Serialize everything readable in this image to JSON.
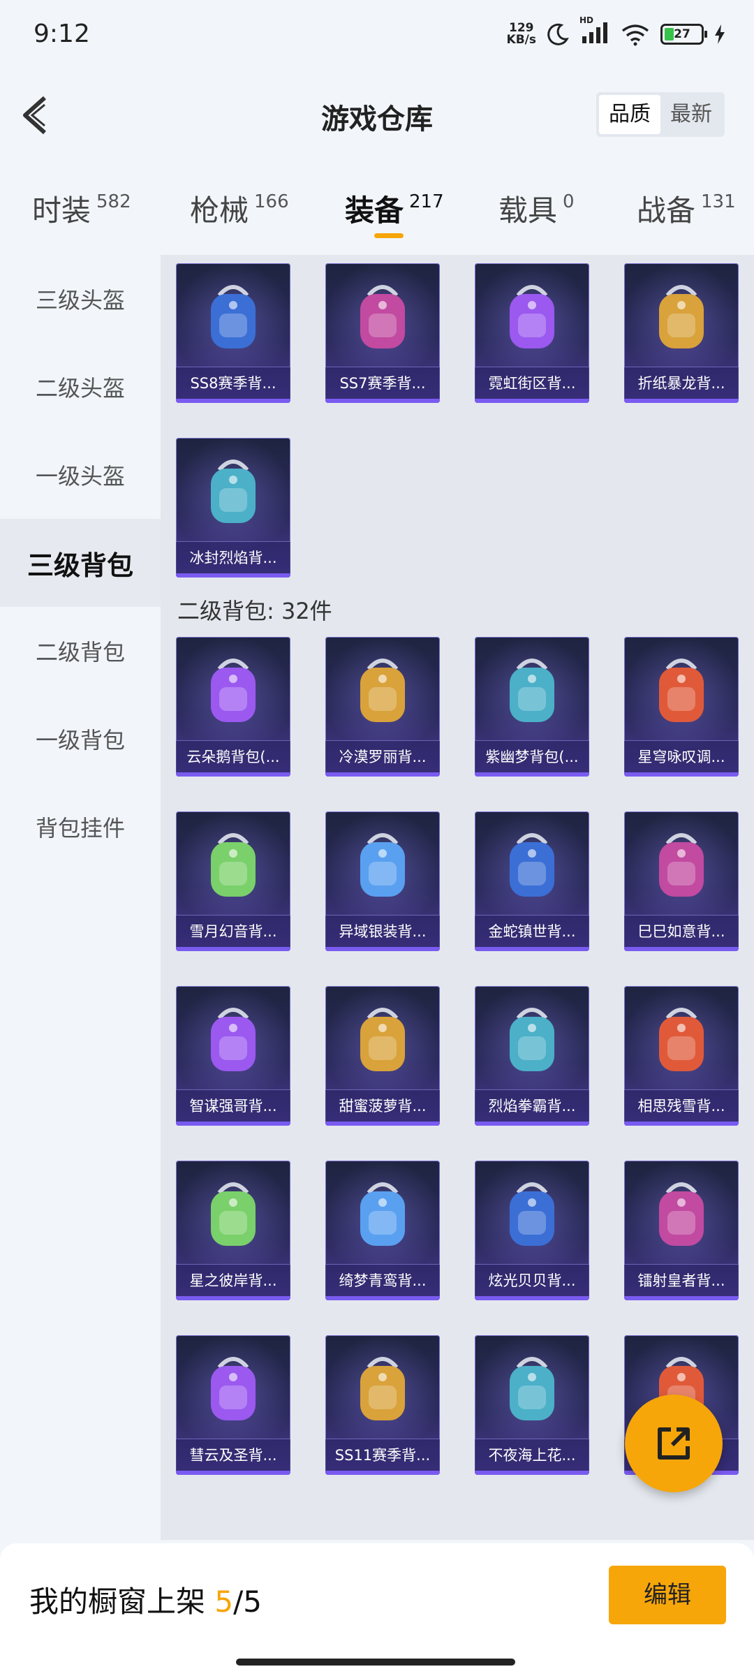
{
  "status_bar": {
    "time": "9:12",
    "net_speed_value": "129",
    "net_speed_unit": "KB/s",
    "hd_label": "HD",
    "battery_level": "27"
  },
  "header": {
    "title": "游戏仓库",
    "sort_options": [
      "品质",
      "最新"
    ],
    "active_sort": "品质"
  },
  "tabs": [
    {
      "label": "时装",
      "count": "582"
    },
    {
      "label": "枪械",
      "count": "166"
    },
    {
      "label": "装备",
      "count": "217"
    },
    {
      "label": "载具",
      "count": "0"
    },
    {
      "label": "战备",
      "count": "131"
    }
  ],
  "active_tab": "装备",
  "sidebar": {
    "items": [
      {
        "label": "三级头盔"
      },
      {
        "label": "二级头盔"
      },
      {
        "label": "一级头盔"
      },
      {
        "label": "三级背包"
      },
      {
        "label": "二级背包"
      },
      {
        "label": "一级背包"
      },
      {
        "label": "背包挂件"
      }
    ],
    "active": "三级背包"
  },
  "level3_items": [
    "SS8赛季背...",
    "SS7赛季背...",
    "霓虹街区背...",
    "折纸暴龙背...",
    "冰封烈焰背..."
  ],
  "level2_section": {
    "title": "二级背包: 32件",
    "items": [
      "云朵鹅背包(...",
      "冷漠罗丽背...",
      "紫幽梦背包(...",
      "星穹咏叹调...",
      "雪月幻音背...",
      "异域银装背...",
      "金蛇镇世背...",
      "巳巳如意背...",
      "智谋强哥背...",
      "甜蜜菠萝背...",
      "烈焰拳霸背...",
      "相思残雪背...",
      "星之彼岸背...",
      "绮梦青鸾背...",
      "炫光贝贝背...",
      "镭射皇者背...",
      "彗云及圣背...",
      "SS11赛季背...",
      "不夜海上花...",
      ""
    ]
  },
  "bottom_bar": {
    "prefix": "我的橱窗上架 ",
    "current": "5",
    "separator": "/",
    "total": "5",
    "edit_label": "编辑"
  },
  "colors": {
    "accent": "#f6a609",
    "card_top": "#1e2440",
    "card_bottom": "#4a3c92",
    "card_strip": "#7a5bf0"
  },
  "icons": [
    "back-arrow-icon",
    "moon-icon",
    "signal-icon",
    "wifi-icon",
    "battery-icon",
    "charging-icon",
    "share-icon"
  ]
}
